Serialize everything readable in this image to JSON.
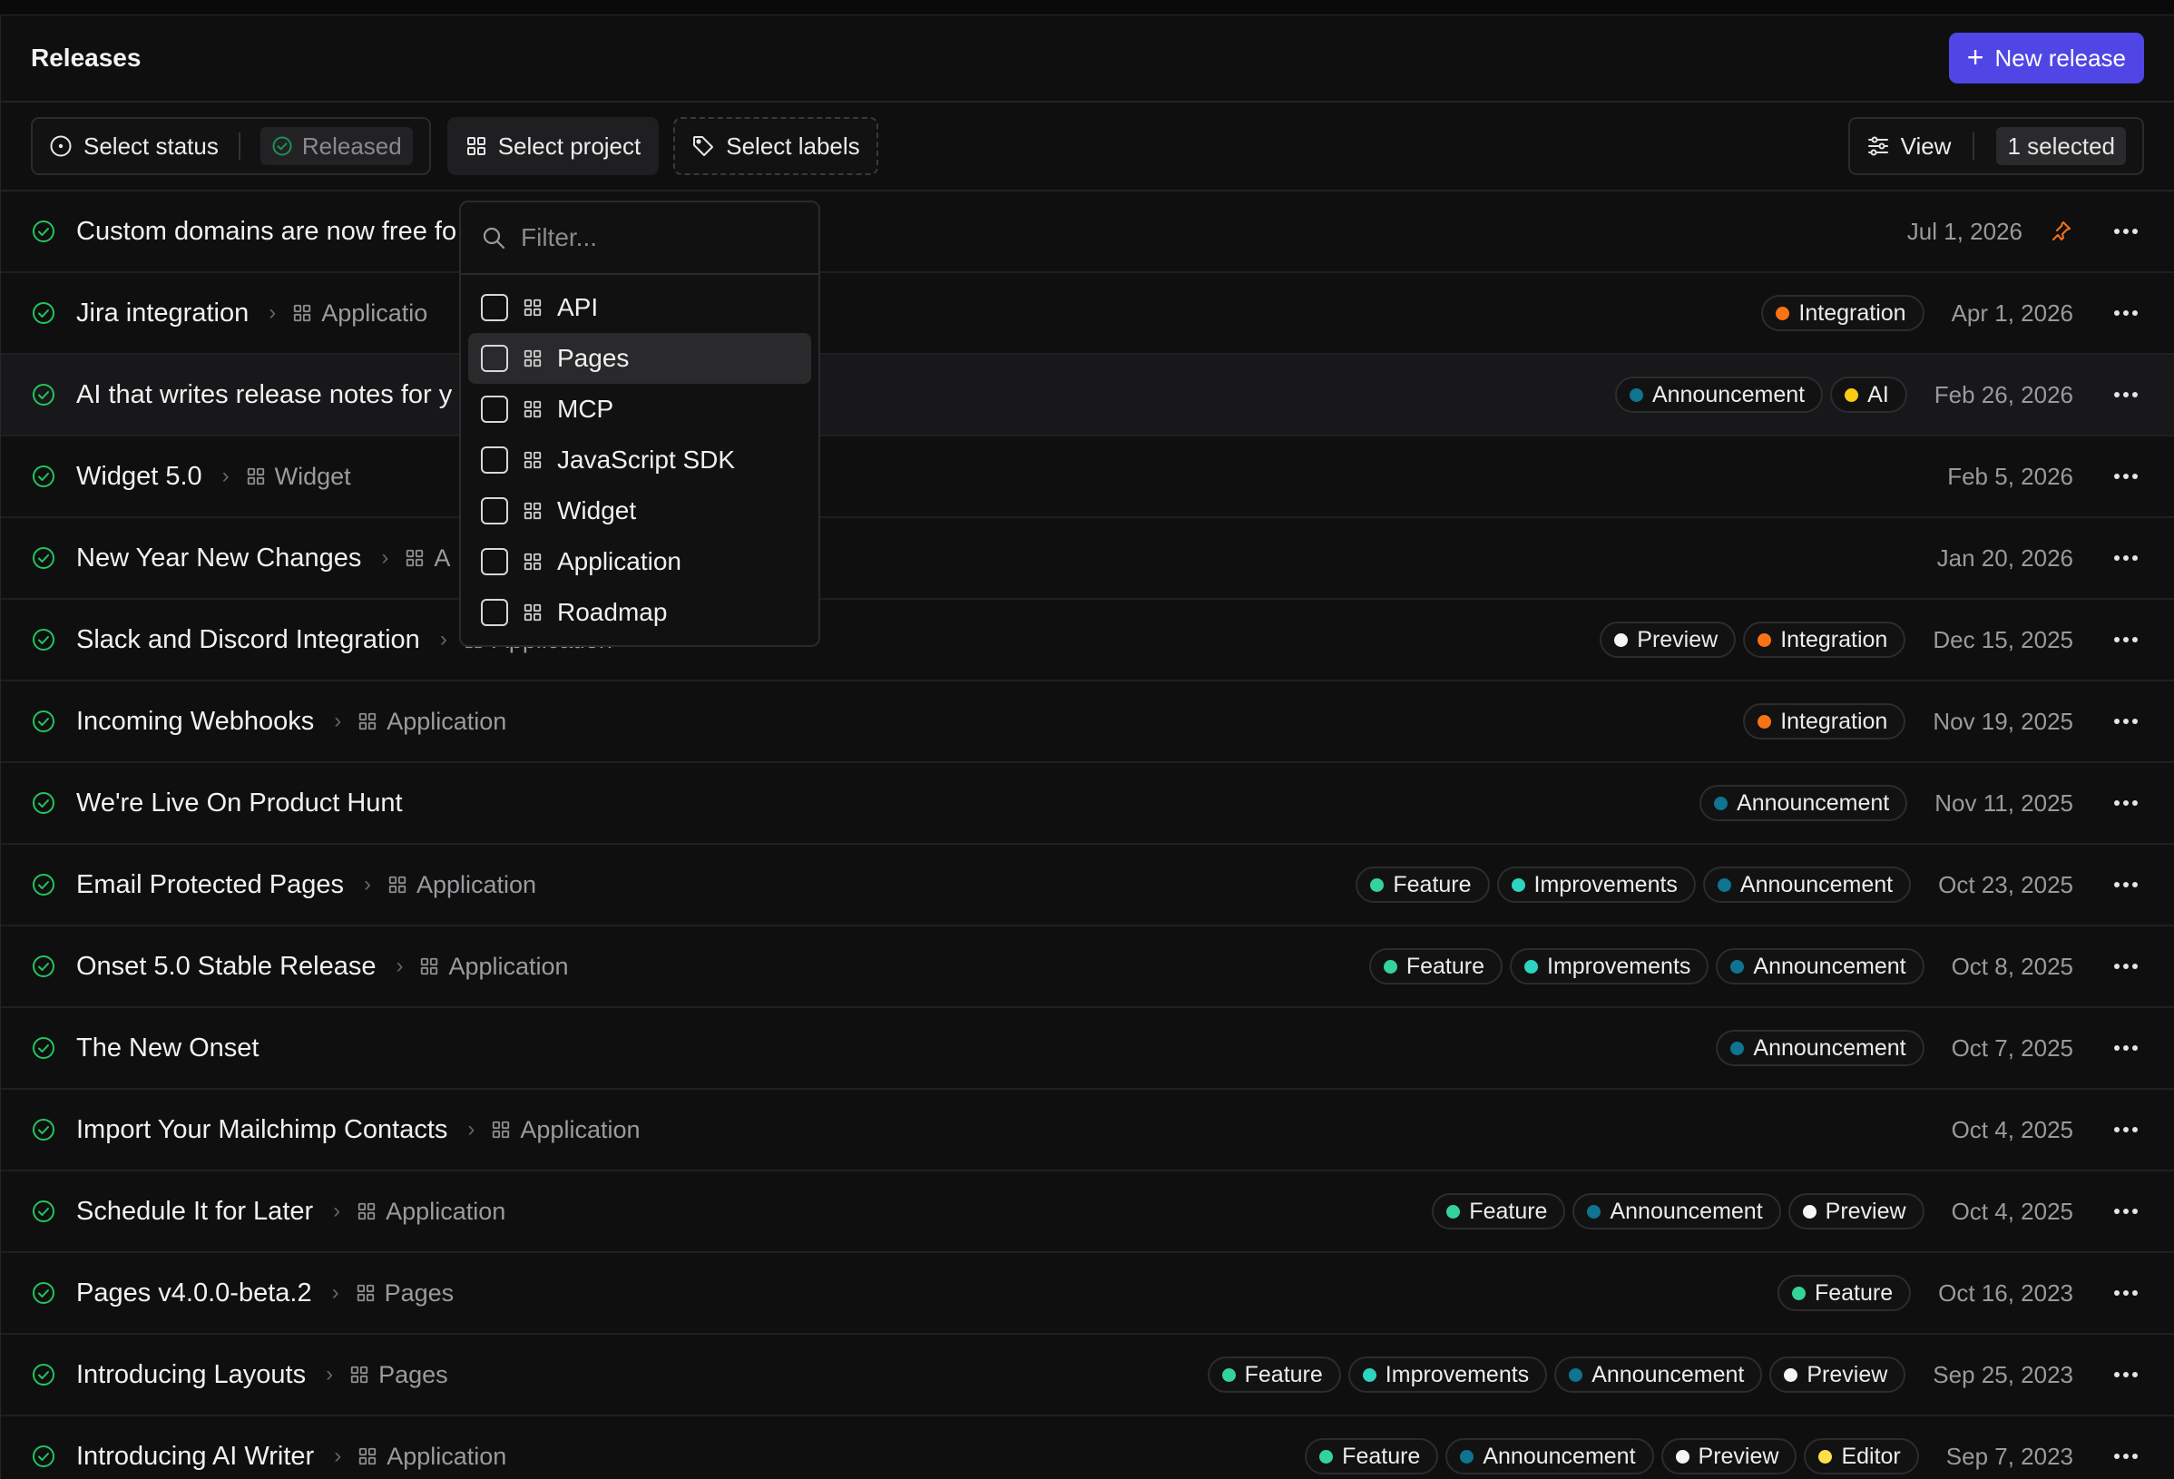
{
  "header": {
    "title": "Releases",
    "new_button": "New release"
  },
  "toolbar": {
    "status_filter": "Select status",
    "status_chip": "Released",
    "project_filter": "Select project",
    "labels_filter": "Select labels",
    "view_button": "View",
    "selected_count": "1 selected"
  },
  "dropdown": {
    "placeholder": "Filter...",
    "items": [
      {
        "label": "API"
      },
      {
        "label": "Pages"
      },
      {
        "label": "MCP"
      },
      {
        "label": "JavaScript SDK"
      },
      {
        "label": "Widget"
      },
      {
        "label": "Application"
      },
      {
        "label": "Roadmap"
      }
    ]
  },
  "colors": {
    "accent": "#4f46e5",
    "status_green": "#22c55e",
    "Integration": "#f97316",
    "Announcement": "#0e7490",
    "AI": "#facc15",
    "Preview": "#f5f5f5",
    "Feature": "#34d399",
    "Improvements": "#2dd4bf",
    "Editor": "#fde047",
    "pin": "#f97316"
  },
  "releases": [
    {
      "name": "Custom domains are now free fo",
      "project": "",
      "labels": [],
      "date": "Jul 1, 2026",
      "pinned": true
    },
    {
      "name": "Jira integration",
      "project": "Applicatio",
      "labels": [
        "Integration"
      ],
      "date": "Apr 1, 2026"
    },
    {
      "name": "AI that writes release notes for y",
      "project": "",
      "labels": [
        "Announcement",
        "AI"
      ],
      "date": "Feb 26, 2026",
      "highlighted": true
    },
    {
      "name": "Widget 5.0",
      "project": "Widget",
      "labels": [],
      "date": "Feb 5, 2026"
    },
    {
      "name": "New Year New Changes",
      "project": "A",
      "labels": [],
      "date": "Jan 20, 2026"
    },
    {
      "name": "Slack and Discord Integration",
      "project": "Application",
      "labels": [
        "Preview",
        "Integration"
      ],
      "date": "Dec 15, 2025"
    },
    {
      "name": "Incoming Webhooks",
      "project": "Application",
      "labels": [
        "Integration"
      ],
      "date": "Nov 19, 2025"
    },
    {
      "name": "We're Live On Product Hunt",
      "project": "",
      "labels": [
        "Announcement"
      ],
      "date": "Nov 11, 2025"
    },
    {
      "name": "Email Protected Pages",
      "project": "Application",
      "labels": [
        "Feature",
        "Improvements",
        "Announcement"
      ],
      "date": "Oct 23, 2025"
    },
    {
      "name": "Onset 5.0 Stable Release",
      "project": "Application",
      "labels": [
        "Feature",
        "Improvements",
        "Announcement"
      ],
      "date": "Oct 8, 2025"
    },
    {
      "name": "The New Onset",
      "project": "",
      "labels": [
        "Announcement"
      ],
      "date": "Oct 7, 2025"
    },
    {
      "name": "Import Your Mailchimp Contacts",
      "project": "Application",
      "labels": [],
      "date": "Oct 4, 2025"
    },
    {
      "name": "Schedule It for Later",
      "project": "Application",
      "labels": [
        "Feature",
        "Announcement",
        "Preview"
      ],
      "date": "Oct 4, 2025"
    },
    {
      "name": "Pages v4.0.0-beta.2",
      "project": "Pages",
      "labels": [
        "Feature"
      ],
      "date": "Oct 16, 2023"
    },
    {
      "name": "Introducing Layouts",
      "project": "Pages",
      "labels": [
        "Feature",
        "Improvements",
        "Announcement",
        "Preview"
      ],
      "date": "Sep 25, 2023"
    },
    {
      "name": "Introducing AI Writer",
      "project": "Application",
      "labels": [
        "Feature",
        "Announcement",
        "Preview",
        "Editor"
      ],
      "date": "Sep 7, 2023"
    }
  ]
}
